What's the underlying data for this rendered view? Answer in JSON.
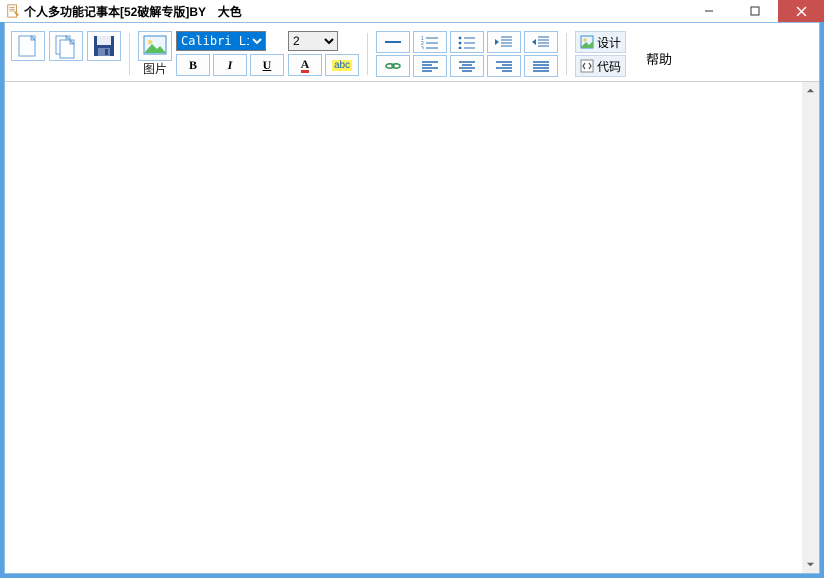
{
  "window": {
    "title": "个人多功能记事本[52破解专版]BY　大色"
  },
  "toolbar": {
    "image_caption": "图片",
    "bold_label": "B",
    "italic_label": "I",
    "underline_label": "U",
    "font_color_label": "A",
    "highlight_label": "abc",
    "font_selected": "Calibri Light",
    "size_selected": "2",
    "design_label": "设计",
    "code_label": "代码"
  },
  "help": {
    "label": "帮助"
  },
  "font_options": [
    "Calibri Light"
  ],
  "size_options": [
    "2"
  ]
}
